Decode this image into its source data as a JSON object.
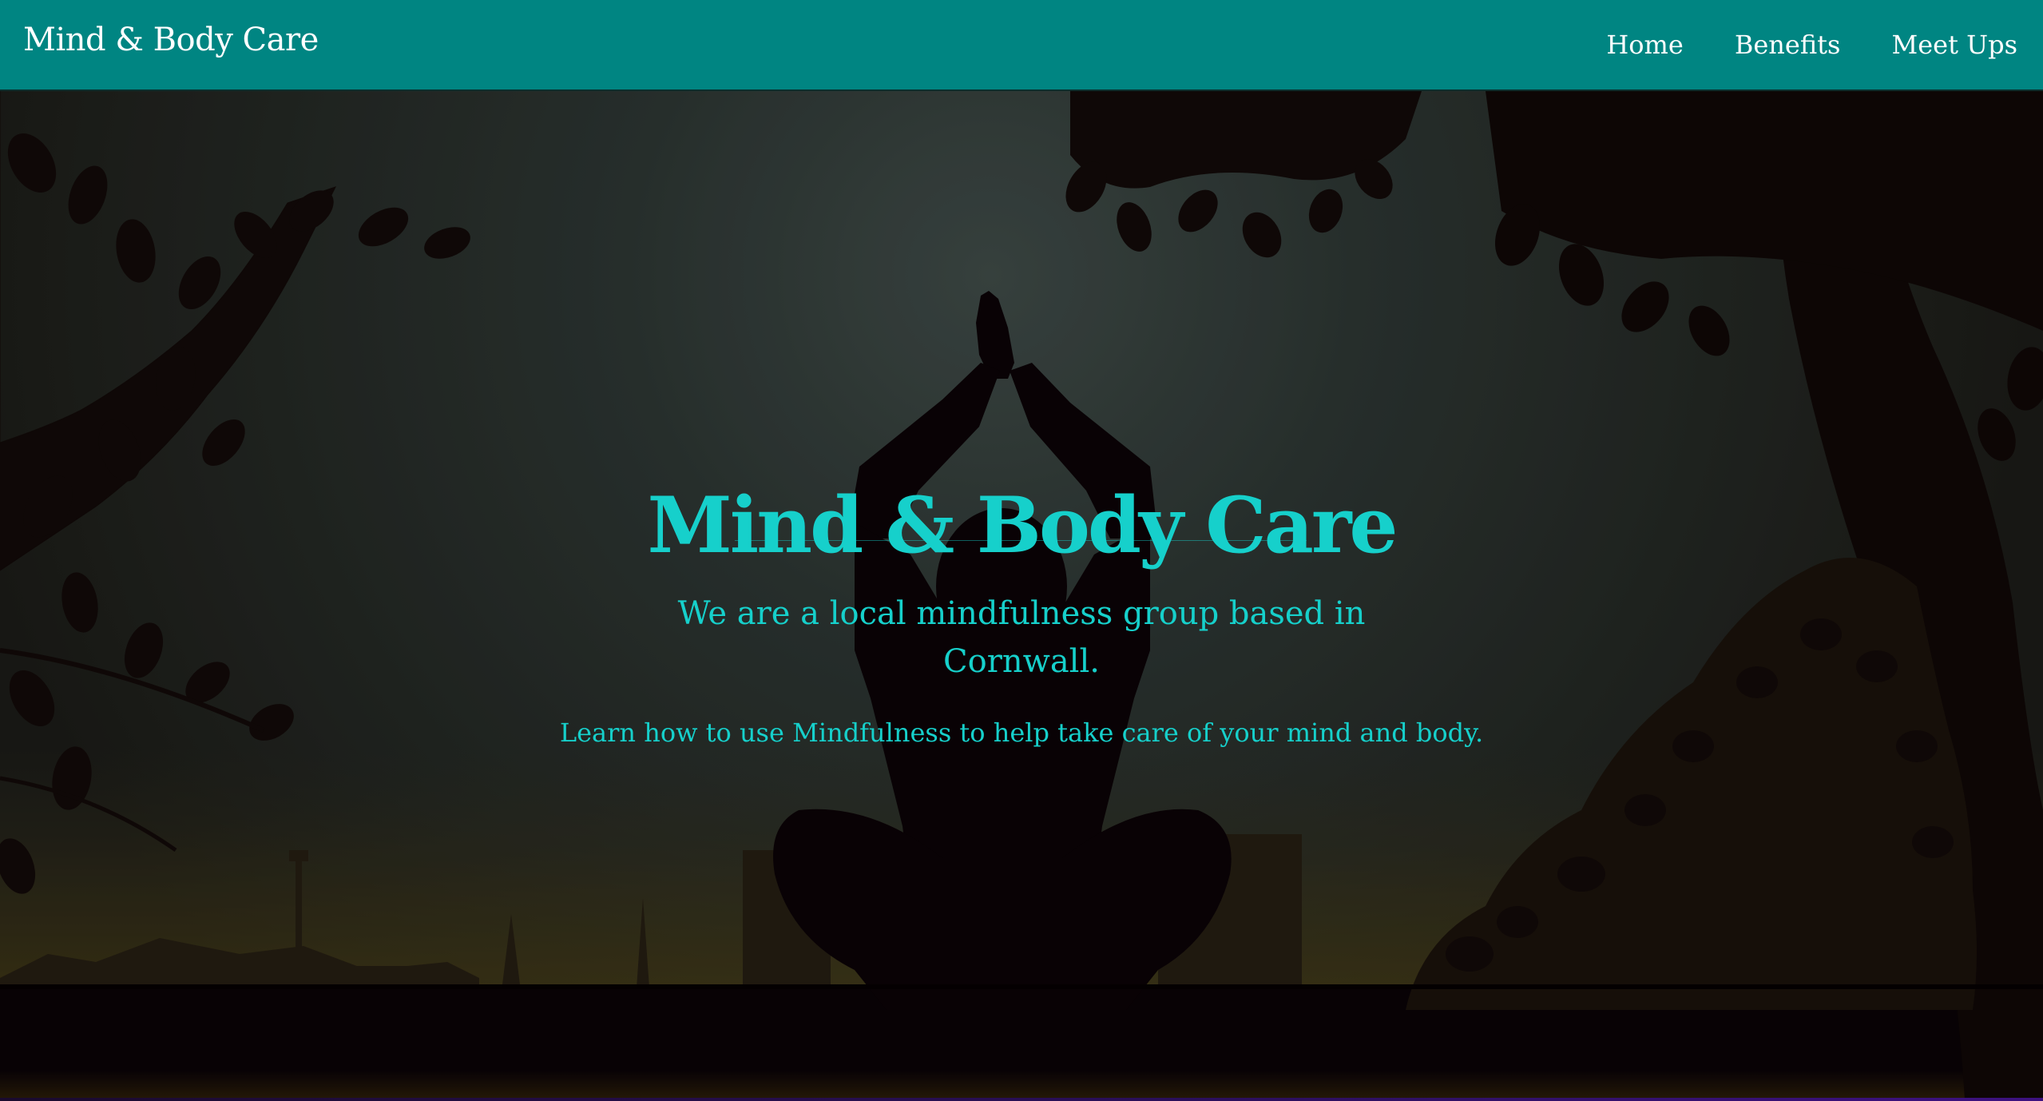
{
  "navbar": {
    "brand": "Mind & Body Care",
    "links": [
      "Home",
      "Benefits",
      "Meet Ups"
    ],
    "background_color": "#008582"
  },
  "hero": {
    "title": "Mind & Body Care",
    "subtitle": "We are a local mindfulness group based in Cornwall.",
    "tagline": "Learn how to use Mindfulness to help take care of your mind and body.",
    "text_color": "#16d0cb"
  },
  "background_image": {
    "scene": "yoga-meditation-silhouette"
  }
}
